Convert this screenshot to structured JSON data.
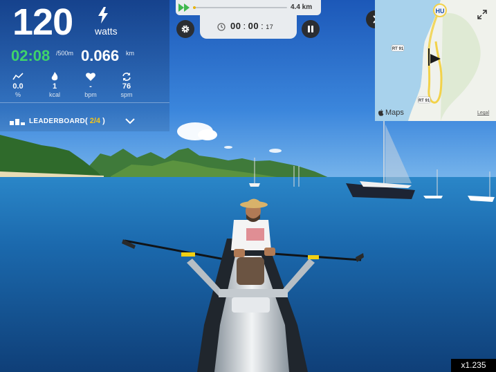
{
  "stats": {
    "watts_value": "120",
    "watts_unit": "watts",
    "split_value": "02:08",
    "split_unit_top": "/",
    "split_unit_bottom": "/500m",
    "distance_value": "0.066",
    "distance_unit": "km",
    "metrics": [
      {
        "icon": "stroke-rate-chart-icon",
        "value": "0.0",
        "unit": "%"
      },
      {
        "icon": "flame-icon",
        "value": "1",
        "unit": "kcal"
      },
      {
        "icon": "heart-icon",
        "value": "-",
        "unit": "bpm"
      },
      {
        "icon": "cycle-arrows-icon",
        "value": "76",
        "unit": "spm"
      }
    ]
  },
  "leaderboard": {
    "label": "LEADERBOARD",
    "rank": "2/4",
    "open_paren": "(",
    "close_paren": ")"
  },
  "route": {
    "total_distance": "4.4 km",
    "progress": 0.015
  },
  "timer": {
    "hours": "00",
    "minutes": "00",
    "seconds": "17"
  },
  "map": {
    "brand": "Maps",
    "legal": "Legal",
    "location_badge": "HU",
    "road_labels": [
      "RT 91",
      "RT 91"
    ]
  },
  "playback": {
    "speed": "x1.235"
  },
  "colors": {
    "split_green": "#3fd46a",
    "rank_yellow": "#f5c518",
    "progress_yellow": "#e8b30d",
    "route_yellow": "#f2d24a",
    "ocean_blue": "#1a4f86"
  }
}
